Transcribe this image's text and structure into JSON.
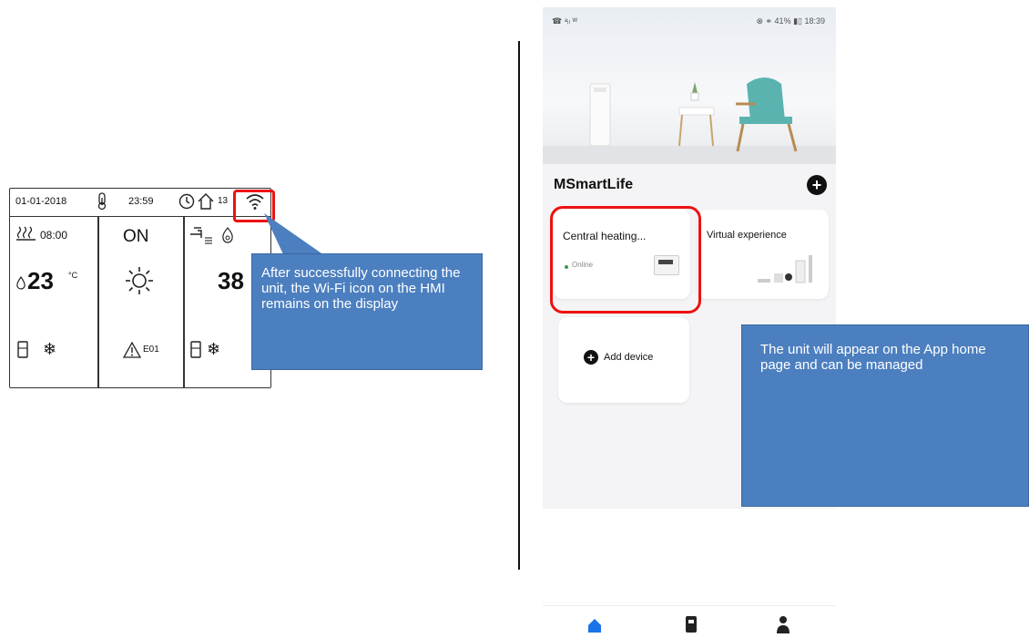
{
  "hmi": {
    "date": "01-01-2018",
    "time": "23:59",
    "clock_value": "13",
    "zone1_time": "08:00",
    "zone1_temp": "23",
    "zone1_unit": "°C",
    "mode_status": "ON",
    "error_code": "E01",
    "zone3_temp": "38"
  },
  "callouts": {
    "hmi_note": "After successfully connecting the unit, the Wi-Fi icon on the HMI remains on the display",
    "app_note": "The unit will appear on the App home page and can be managed"
  },
  "phone": {
    "status_left": "☎ ᵃᵢₗ ᵂ",
    "status_right": "⊗ ⚭ 41% ▮▯ 18:39",
    "app_title": "MSmartLife",
    "device_card_name": "Central heating...",
    "device_card_status": "Online",
    "virtual_card_name": "Virtual experience",
    "add_device_label": "Add device"
  },
  "colors": {
    "callout_blue": "#4c7fbf",
    "highlight_red": "#e11111",
    "nav_active": "#1a73e8"
  },
  "icons": [
    "thermostat-icon",
    "clock-icon",
    "house-icon",
    "wifi-icon",
    "radiator-icon",
    "water-drop-icon",
    "sun-icon",
    "warning-icon",
    "tank-icon",
    "snowflake-icon",
    "tap-icon",
    "plus-icon",
    "home-icon",
    "device-icon",
    "person-icon"
  ]
}
